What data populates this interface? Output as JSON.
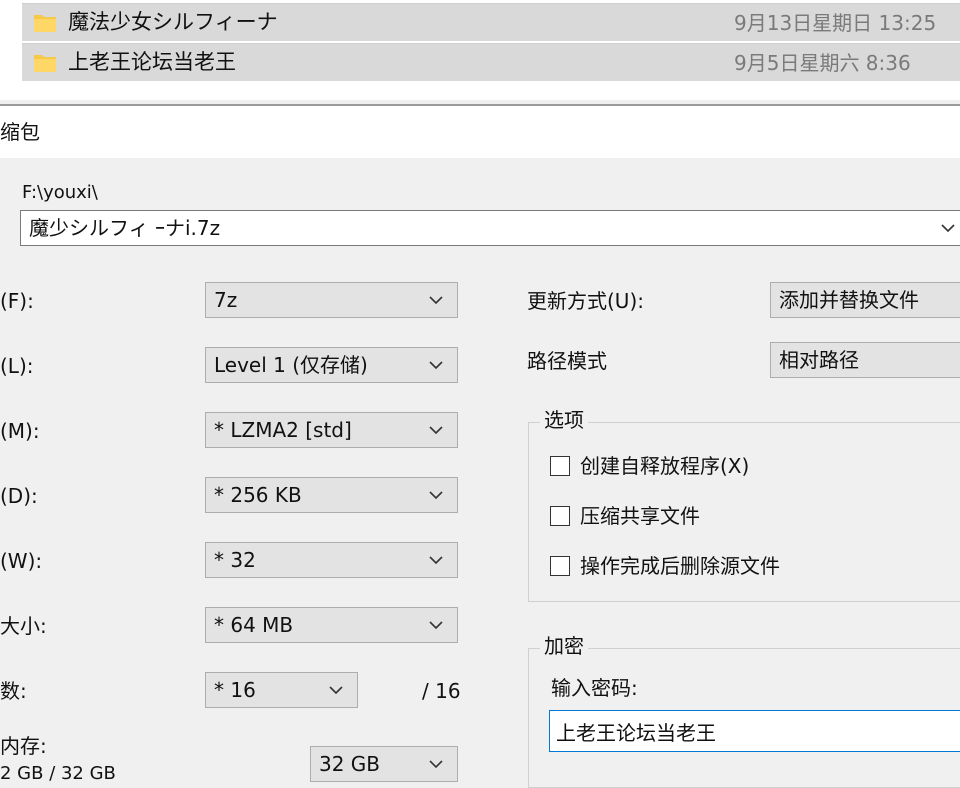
{
  "explorer": {
    "files": [
      {
        "name": "魔法少女シルフィーナ",
        "date": "9月13日星期日 13:25"
      },
      {
        "name": "上老王论坛当老王",
        "date": "9月5日星期六 8:36"
      }
    ]
  },
  "dialog": {
    "title": "缩包",
    "path": "F:\\youxi\\",
    "archive_name": "魔少シルフィ ｰナi.7z",
    "left_fields": [
      {
        "label": "(F):",
        "value": "7z"
      },
      {
        "label": "(L):",
        "value": "Level 1 (仅存储)"
      },
      {
        "label": "(M):",
        "value": "* LZMA2 [std]"
      },
      {
        "label": "(D):",
        "value": "* 256 KB"
      },
      {
        "label": "(W):",
        "value": "* 32"
      },
      {
        "label": "大小:",
        "value": "* 64 MB"
      },
      {
        "label": "数:",
        "value": "* 16",
        "suffix": "/ 16"
      }
    ],
    "memory": {
      "label": "内存:",
      "sub": "2 GB / 32 GB",
      "value": "32 GB"
    },
    "update_mode": {
      "label": "更新方式(U):",
      "value": "添加并替换文件"
    },
    "path_mode": {
      "label": "路径模式",
      "value": "相对路径"
    },
    "options": {
      "title": "选项",
      "items": [
        {
          "label": "创建自释放程序(X)",
          "checked": false
        },
        {
          "label": "压缩共享文件",
          "checked": false
        },
        {
          "label": "操作完成后删除源文件",
          "checked": false
        }
      ]
    },
    "encryption": {
      "title": "加密",
      "password_label": "输入密码:",
      "password_value": "上老王论坛当老王"
    }
  }
}
